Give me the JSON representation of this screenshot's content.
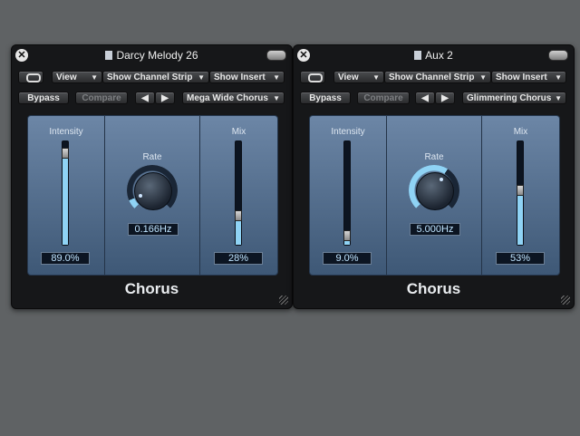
{
  "windows": [
    {
      "title": "Darcy Melody 26",
      "view_label": "View",
      "channel_strip_label": "Show Channel Strip",
      "insert_label": "Show Insert",
      "bypass_label": "Bypass",
      "compare_label": "Compare",
      "prev_glyph": "◀",
      "next_glyph": "▶",
      "preset": "Mega Wide Chorus",
      "intensity_label": "Intensity",
      "intensity_value": "89.0%",
      "intensity_level": 0.89,
      "rate_label": "Rate",
      "rate_value": "0.166Hz",
      "rate_level": 0.08,
      "mix_label": "Mix",
      "mix_value": "28%",
      "mix_level": 0.28,
      "plugin_name": "Chorus"
    },
    {
      "title": "Aux 2",
      "view_label": "View",
      "channel_strip_label": "Show Channel Strip",
      "insert_label": "Show Insert",
      "bypass_label": "Bypass",
      "compare_label": "Compare",
      "prev_glyph": "◀",
      "next_glyph": "▶",
      "preset": "Glimmering Chorus",
      "intensity_label": "Intensity",
      "intensity_value": "9.0%",
      "intensity_level": 0.09,
      "rate_label": "Rate",
      "rate_value": "5.000Hz",
      "rate_level": 0.62,
      "mix_label": "Mix",
      "mix_value": "53%",
      "mix_level": 0.53,
      "plugin_name": "Chorus"
    }
  ],
  "colors": {
    "background": "#5f6264",
    "window": "#161719",
    "panel": "#5a7595",
    "fill": "#8fd3f5"
  }
}
